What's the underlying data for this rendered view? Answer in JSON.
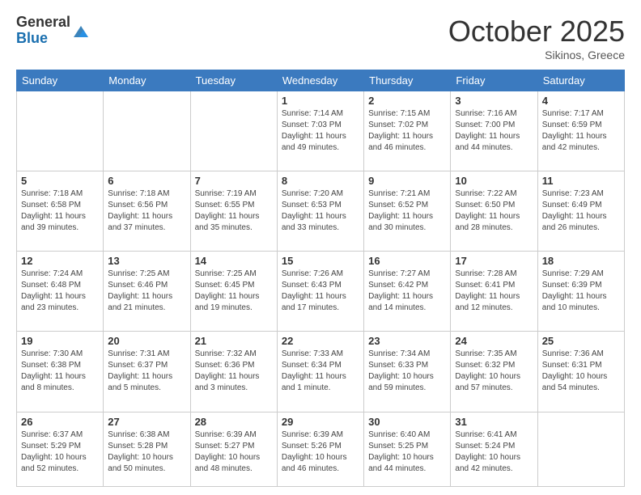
{
  "header": {
    "logo_general": "General",
    "logo_blue": "Blue",
    "month_title": "October 2025",
    "subtitle": "Sikinos, Greece"
  },
  "days_of_week": [
    "Sunday",
    "Monday",
    "Tuesday",
    "Wednesday",
    "Thursday",
    "Friday",
    "Saturday"
  ],
  "weeks": [
    [
      {
        "day": "",
        "info": ""
      },
      {
        "day": "",
        "info": ""
      },
      {
        "day": "",
        "info": ""
      },
      {
        "day": "1",
        "info": "Sunrise: 7:14 AM\nSunset: 7:03 PM\nDaylight: 11 hours\nand 49 minutes."
      },
      {
        "day": "2",
        "info": "Sunrise: 7:15 AM\nSunset: 7:02 PM\nDaylight: 11 hours\nand 46 minutes."
      },
      {
        "day": "3",
        "info": "Sunrise: 7:16 AM\nSunset: 7:00 PM\nDaylight: 11 hours\nand 44 minutes."
      },
      {
        "day": "4",
        "info": "Sunrise: 7:17 AM\nSunset: 6:59 PM\nDaylight: 11 hours\nand 42 minutes."
      }
    ],
    [
      {
        "day": "5",
        "info": "Sunrise: 7:18 AM\nSunset: 6:58 PM\nDaylight: 11 hours\nand 39 minutes."
      },
      {
        "day": "6",
        "info": "Sunrise: 7:18 AM\nSunset: 6:56 PM\nDaylight: 11 hours\nand 37 minutes."
      },
      {
        "day": "7",
        "info": "Sunrise: 7:19 AM\nSunset: 6:55 PM\nDaylight: 11 hours\nand 35 minutes."
      },
      {
        "day": "8",
        "info": "Sunrise: 7:20 AM\nSunset: 6:53 PM\nDaylight: 11 hours\nand 33 minutes."
      },
      {
        "day": "9",
        "info": "Sunrise: 7:21 AM\nSunset: 6:52 PM\nDaylight: 11 hours\nand 30 minutes."
      },
      {
        "day": "10",
        "info": "Sunrise: 7:22 AM\nSunset: 6:50 PM\nDaylight: 11 hours\nand 28 minutes."
      },
      {
        "day": "11",
        "info": "Sunrise: 7:23 AM\nSunset: 6:49 PM\nDaylight: 11 hours\nand 26 minutes."
      }
    ],
    [
      {
        "day": "12",
        "info": "Sunrise: 7:24 AM\nSunset: 6:48 PM\nDaylight: 11 hours\nand 23 minutes."
      },
      {
        "day": "13",
        "info": "Sunrise: 7:25 AM\nSunset: 6:46 PM\nDaylight: 11 hours\nand 21 minutes."
      },
      {
        "day": "14",
        "info": "Sunrise: 7:25 AM\nSunset: 6:45 PM\nDaylight: 11 hours\nand 19 minutes."
      },
      {
        "day": "15",
        "info": "Sunrise: 7:26 AM\nSunset: 6:43 PM\nDaylight: 11 hours\nand 17 minutes."
      },
      {
        "day": "16",
        "info": "Sunrise: 7:27 AM\nSunset: 6:42 PM\nDaylight: 11 hours\nand 14 minutes."
      },
      {
        "day": "17",
        "info": "Sunrise: 7:28 AM\nSunset: 6:41 PM\nDaylight: 11 hours\nand 12 minutes."
      },
      {
        "day": "18",
        "info": "Sunrise: 7:29 AM\nSunset: 6:39 PM\nDaylight: 11 hours\nand 10 minutes."
      }
    ],
    [
      {
        "day": "19",
        "info": "Sunrise: 7:30 AM\nSunset: 6:38 PM\nDaylight: 11 hours\nand 8 minutes."
      },
      {
        "day": "20",
        "info": "Sunrise: 7:31 AM\nSunset: 6:37 PM\nDaylight: 11 hours\nand 5 minutes."
      },
      {
        "day": "21",
        "info": "Sunrise: 7:32 AM\nSunset: 6:36 PM\nDaylight: 11 hours\nand 3 minutes."
      },
      {
        "day": "22",
        "info": "Sunrise: 7:33 AM\nSunset: 6:34 PM\nDaylight: 11 hours\nand 1 minute."
      },
      {
        "day": "23",
        "info": "Sunrise: 7:34 AM\nSunset: 6:33 PM\nDaylight: 10 hours\nand 59 minutes."
      },
      {
        "day": "24",
        "info": "Sunrise: 7:35 AM\nSunset: 6:32 PM\nDaylight: 10 hours\nand 57 minutes."
      },
      {
        "day": "25",
        "info": "Sunrise: 7:36 AM\nSunset: 6:31 PM\nDaylight: 10 hours\nand 54 minutes."
      }
    ],
    [
      {
        "day": "26",
        "info": "Sunrise: 6:37 AM\nSunset: 5:29 PM\nDaylight: 10 hours\nand 52 minutes."
      },
      {
        "day": "27",
        "info": "Sunrise: 6:38 AM\nSunset: 5:28 PM\nDaylight: 10 hours\nand 50 minutes."
      },
      {
        "day": "28",
        "info": "Sunrise: 6:39 AM\nSunset: 5:27 PM\nDaylight: 10 hours\nand 48 minutes."
      },
      {
        "day": "29",
        "info": "Sunrise: 6:39 AM\nSunset: 5:26 PM\nDaylight: 10 hours\nand 46 minutes."
      },
      {
        "day": "30",
        "info": "Sunrise: 6:40 AM\nSunset: 5:25 PM\nDaylight: 10 hours\nand 44 minutes."
      },
      {
        "day": "31",
        "info": "Sunrise: 6:41 AM\nSunset: 5:24 PM\nDaylight: 10 hours\nand 42 minutes."
      },
      {
        "day": "",
        "info": ""
      }
    ]
  ]
}
